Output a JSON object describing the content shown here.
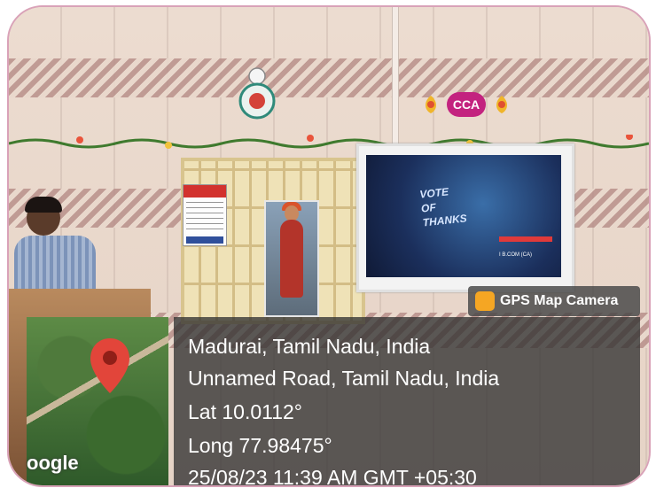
{
  "wall": {
    "emblem_icon": "wall-clock-emblem-icon",
    "cca_badge": "CCA"
  },
  "slide": {
    "title": "VOTE OF THANKS",
    "subtitle": "I B.COM (CA)"
  },
  "overlay": {
    "app_badge_icon": "gps-map-camera-icon",
    "app_badge_label": "GPS Map Camera",
    "map_pin_icon": "map-pin-icon",
    "map_attribution": "oogle",
    "location_line1": "Madurai, Tamil Nadu, India",
    "location_line2": "Unnamed Road, Tamil Nadu, India",
    "latitude": "Lat 10.0112°",
    "longitude": "Long 77.98475°",
    "timestamp": "25/08/23 11:39 AM GMT +05:30"
  },
  "colors": {
    "overlay_bg": "#323232",
    "pin_red": "#e2453a",
    "cca_pink": "#c3237f"
  }
}
